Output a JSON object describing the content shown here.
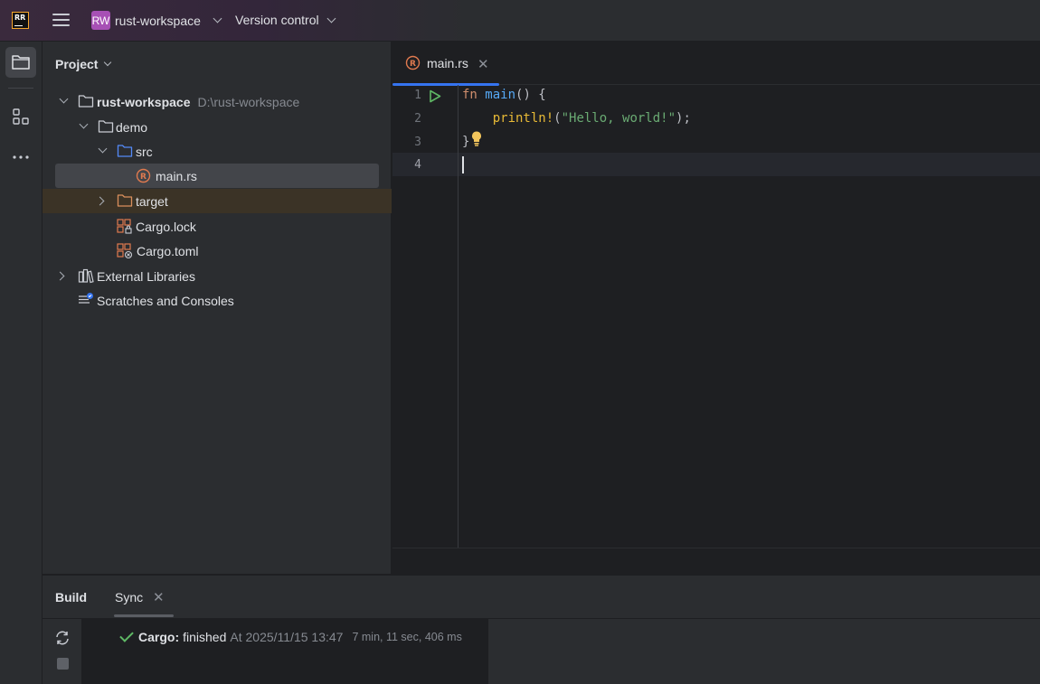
{
  "titlebar": {
    "project_badge": "RW",
    "project_name": "rust-workspace",
    "vcs_label": "Version control"
  },
  "project_panel": {
    "title": "Project",
    "tree": {
      "root_name": "rust-workspace",
      "root_path": "D:\\rust-workspace",
      "demo": "demo",
      "src": "src",
      "main_rs": "main.rs",
      "target": "target",
      "cargo_lock": "Cargo.lock",
      "cargo_toml": "Cargo.toml",
      "external_libraries": "External Libraries",
      "scratches": "Scratches and Consoles"
    }
  },
  "editor": {
    "tab_label": "main.rs",
    "line_numbers": [
      "1",
      "2",
      "3",
      "4"
    ],
    "code": {
      "l1_kw": "fn",
      "l1_fn": "main",
      "l1_rest": "() {",
      "l2_macro": "println!",
      "l2_open": "(",
      "l2_str": "\"Hello, world!\"",
      "l2_close": ");",
      "l3": "}"
    }
  },
  "build_panel": {
    "tab_build": "Build",
    "tab_sync": "Sync",
    "result_source": "Cargo:",
    "result_status": "finished",
    "result_time": "At 2025/11/15 13:47",
    "result_duration": "7 min, 11 sec, 406 ms"
  },
  "colors": {
    "accent": "#3574f0",
    "success": "#5fb865",
    "badge": "#a750b5",
    "rust_icon": "#e07a4f"
  }
}
